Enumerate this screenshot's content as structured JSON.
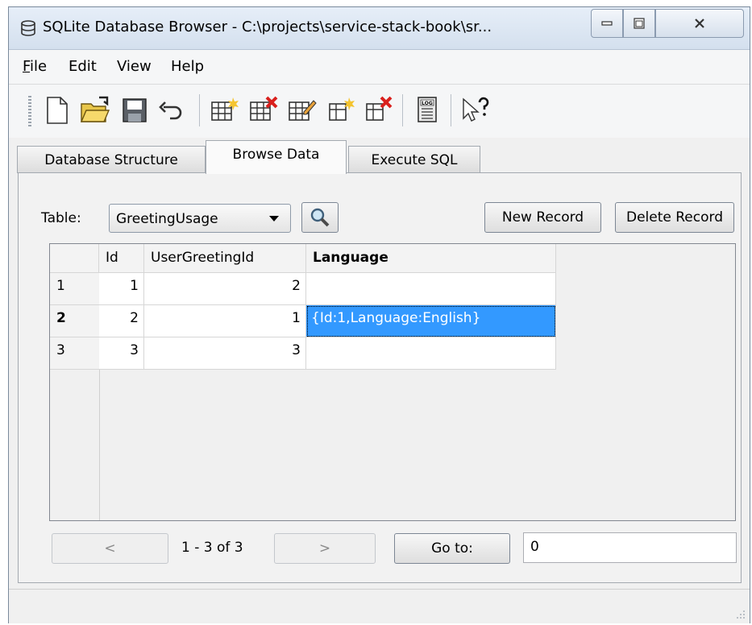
{
  "window": {
    "title": "SQLite Database Browser - C:\\projects\\service-stack-book\\sr...",
    "app_icon": "database-icon"
  },
  "menu": {
    "items": [
      "File",
      "Edit",
      "View",
      "Help"
    ]
  },
  "toolbar": {
    "buttons": [
      "new-database-icon",
      "open-database-icon",
      "save-icon",
      "undo-icon",
      "create-table-icon",
      "delete-table-icon",
      "modify-table-icon",
      "create-index-icon",
      "delete-index-icon",
      "sql-log-icon",
      "whats-this-icon"
    ],
    "log_label": "LOG"
  },
  "tabs": [
    {
      "label": "Database Structure",
      "active": false
    },
    {
      "label": "Browse Data",
      "active": true
    },
    {
      "label": "Execute SQL",
      "active": false
    }
  ],
  "browse": {
    "table_label": "Table:",
    "table_value": "GreetingUsage",
    "new_record": "New Record",
    "delete_record": "Delete Record",
    "columns": [
      "Id",
      "UserGreetingId",
      "Language"
    ],
    "rows": [
      {
        "row_header": "1",
        "cells": [
          "1",
          "2",
          ""
        ]
      },
      {
        "row_header": "2",
        "cells": [
          "2",
          "1",
          "{Id:1,Language:English}"
        ]
      },
      {
        "row_header": "3",
        "cells": [
          "3",
          "3",
          ""
        ]
      }
    ],
    "selected_row": 2,
    "selected_column": "Language"
  },
  "nav": {
    "prev": "<",
    "page_info": "1 - 3 of 3",
    "next": ">",
    "goto_label": "Go to:",
    "goto_value": "0"
  },
  "colors": {
    "selection": "#3399ff",
    "title_bar": "#dde7f3"
  }
}
